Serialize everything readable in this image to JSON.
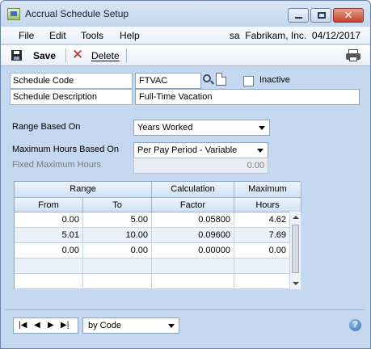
{
  "window": {
    "title": "Accrual Schedule Setup"
  },
  "menu": {
    "items": [
      "File",
      "Edit",
      "Tools",
      "Help"
    ],
    "context": "sa  Fabrikam, Inc.  04/12/2017"
  },
  "toolbar": {
    "save_label": "Save",
    "delete_label": "Delete"
  },
  "form": {
    "schedule_code_label": "Schedule Code",
    "schedule_code_value": "FTVAC",
    "inactive_label": "Inactive",
    "inactive_checked": false,
    "schedule_description_label": "Schedule Description",
    "schedule_description_value": "Full-Time Vacation",
    "range_based_on_label": "Range Based On",
    "range_based_on_value": "Years Worked",
    "max_hours_based_on_label": "Maximum Hours Based On",
    "max_hours_based_on_value": "Per Pay Period - Variable",
    "fixed_max_hours_label": "Fixed Maximum Hours",
    "fixed_max_hours_value": "0.00"
  },
  "grid": {
    "header_range": "Range",
    "header_calculation": "Calculation",
    "header_maximum": "Maximum",
    "header_from": "From",
    "header_to": "To",
    "header_factor": "Factor",
    "header_hours": "Hours",
    "rows": [
      [
        "0.00",
        "5.00",
        "0.05800",
        "4.62"
      ],
      [
        "5.01",
        "10.00",
        "0.09600",
        "7.69"
      ],
      [
        "0.00",
        "0.00",
        "0.00000",
        "0.00"
      ],
      [
        "",
        "",
        "",
        ""
      ],
      [
        "",
        "",
        "",
        ""
      ]
    ]
  },
  "bottom": {
    "sort_value": "by Code",
    "help_glyph": "?"
  },
  "icons": [
    "app-icon",
    "minimize-icon",
    "maximize-icon",
    "close-icon",
    "save-icon",
    "delete-icon",
    "print-icon",
    "lookup-icon",
    "note-icon",
    "first-record-icon",
    "previous-record-icon",
    "next-record-icon",
    "last-record-icon",
    "help-icon"
  ]
}
